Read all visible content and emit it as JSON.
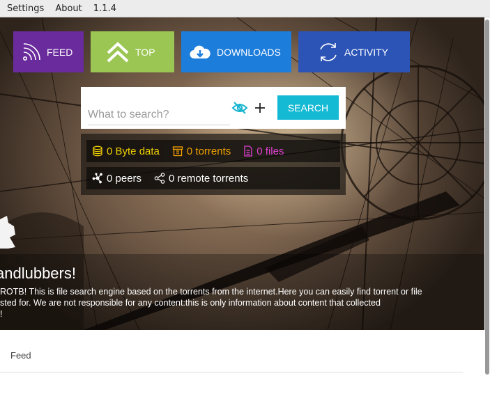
{
  "menubar": {
    "items": [
      "Settings",
      "About",
      "1.1.4"
    ]
  },
  "nav": {
    "feed": "FEED",
    "top": "TOP",
    "downloads": "DOWNLOADS",
    "activity": "ACTIVITY"
  },
  "search": {
    "placeholder": "What to search?",
    "button": "SEARCH"
  },
  "stats": {
    "data": "0 Byte data",
    "torrents": "0 torrents",
    "files": "0 files",
    "peers": "0 peers",
    "remote": "0 remote torrents"
  },
  "welcome": {
    "title": "andlubbers!",
    "line1": "ROTB! This is file search engine based on the torrents from the internet.Here you can easily find torrent or file",
    "line2": "sted for. We are not responsible for any content:this is only information about content that collected",
    "line3": "!"
  },
  "feed_section": {
    "label": "Feed"
  },
  "colors": {
    "feed": "#6a2b9c",
    "top": "#9bc653",
    "downloads": "#1d7ddb",
    "activity": "#2c54b7",
    "search_button": "#14b9d4",
    "stat_data": "#f0d000",
    "stat_torrents": "#f0a000",
    "stat_files": "#e040d0"
  },
  "icons": {
    "feed": "rss-icon",
    "top": "double-chevron-up-icon",
    "downloads": "cloud-download-icon",
    "activity": "refresh-icon",
    "eye": "eye-off-icon",
    "plus": "plus-icon",
    "data": "database-icon",
    "torrents": "archive-icon",
    "files": "file-icon",
    "peers": "network-icon",
    "remote": "share-icon"
  }
}
